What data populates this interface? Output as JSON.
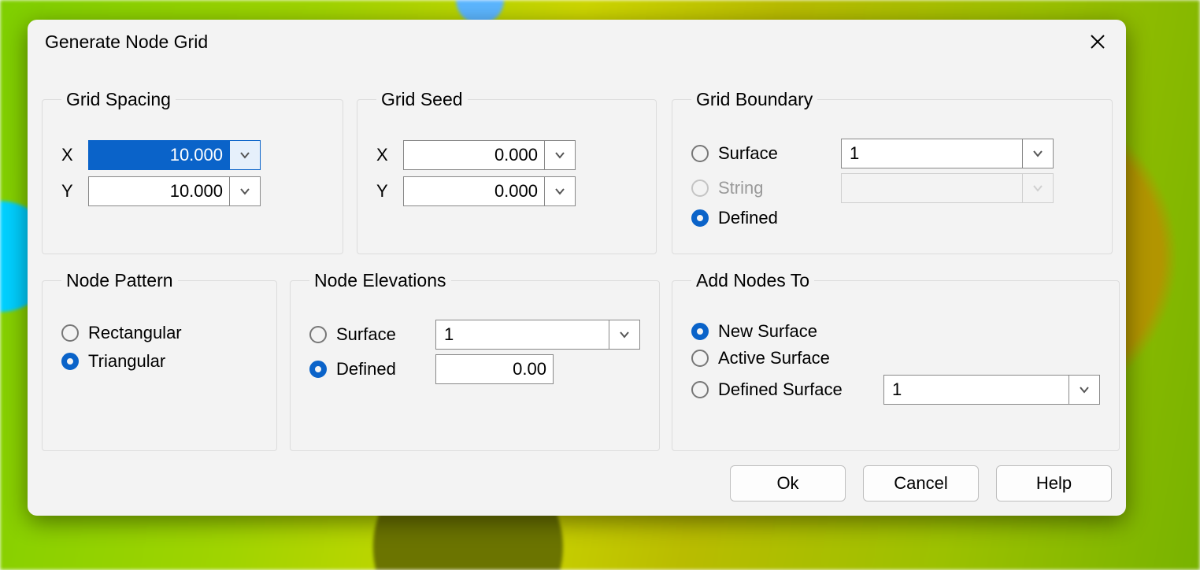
{
  "dialog": {
    "title": "Generate Node Grid"
  },
  "gridSpacing": {
    "legend": "Grid Spacing",
    "xLabel": "X",
    "xValue": "10.000",
    "yLabel": "Y",
    "yValue": "10.000"
  },
  "gridSeed": {
    "legend": "Grid Seed",
    "xLabel": "X",
    "xValue": "0.000",
    "yLabel": "Y",
    "yValue": "0.000"
  },
  "gridBoundary": {
    "legend": "Grid Boundary",
    "surfaceLabel": "Surface",
    "surfaceValue": "1",
    "stringLabel": "String",
    "stringValue": "",
    "definedLabel": "Defined",
    "selected": "Defined"
  },
  "nodePattern": {
    "legend": "Node Pattern",
    "rectLabel": "Rectangular",
    "triLabel": "Triangular",
    "selected": "Triangular"
  },
  "nodeElevations": {
    "legend": "Node Elevations",
    "surfaceLabel": "Surface",
    "surfaceValue": "1",
    "definedLabel": "Defined",
    "definedValue": "0.00",
    "selected": "Defined"
  },
  "addNodesTo": {
    "legend": "Add Nodes To",
    "newLabel": "New Surface",
    "activeLabel": "Active Surface",
    "definedLabel": "Defined Surface",
    "definedValue": "1",
    "selected": "New Surface"
  },
  "buttons": {
    "ok": "Ok",
    "cancel": "Cancel",
    "help": "Help"
  }
}
